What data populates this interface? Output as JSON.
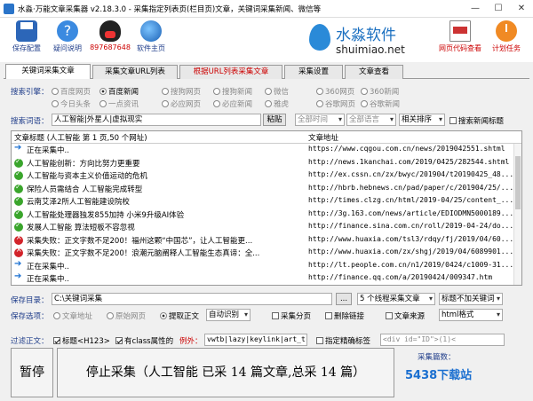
{
  "window": {
    "title": "水淼·万能文章采集器 v2.18.3.0 - 采集指定列表页(栏目页)文章，关键词采集新闻、微信等",
    "min": "—",
    "max": "☐",
    "close": "✕"
  },
  "toolbar": {
    "save": "保存配置",
    "help": "疑问说明",
    "qq": "897687648",
    "site": "软件主页",
    "logo_cn": "水淼软件",
    "logo_en": "shuimiao.net",
    "code": "网页代码查看",
    "plan": "计划任务"
  },
  "tabs": [
    "关键词采集文章",
    "采集文章URL列表",
    "根据URL列表采集文章",
    "采集设置",
    "文章查看"
  ],
  "engine": {
    "label": "搜索引擎：",
    "options": [
      "百度网页",
      "百度新闻",
      "搜狗网页",
      "搜狗新闻",
      "微信",
      "360网页",
      "360新闻",
      "今日头条",
      "一点资讯",
      "必应网页",
      "必应新闻",
      "雅虎",
      "谷歌网页",
      "谷歌新闻"
    ],
    "selected": "百度新闻"
  },
  "search": {
    "label": "搜索词语：",
    "value": "人工智能|外星人|虚拟现实",
    "paste": "粘贴",
    "time": "全部时间",
    "lang": "全部语言",
    "sort": "相关排序",
    "checkbox": "搜索新闻标题"
  },
  "table": {
    "col_title": "文章标题 (人工智能 第 1 页,50 个网址)",
    "col_url": "文章地址",
    "rows": [
      {
        "status": "arr",
        "title": "正在采集中..",
        "url": "https://www.cqgou.com.cn/news/2019042551.shtml"
      },
      {
        "status": "ok",
        "title": "人工智能创新：方向比努力更重要",
        "url": "http://news.1kanchai.com/2019/0425/282544.shtml"
      },
      {
        "status": "ok",
        "title": "人工智能与资本主义价值运动的危机",
        "url": "http://ex.cssn.cn/zx/bwyc/201904/t20190425_48..."
      },
      {
        "status": "ok",
        "title": "保险人员需结合 人工智能完成转型",
        "url": "http://hbrb.hebnews.cn/pad/paper/c/201904/25/..."
      },
      {
        "status": "ok",
        "title": "云南艾泽2所人工智能建设院校",
        "url": "http://times.clzg.cn/html/2019-04/25/content_..."
      },
      {
        "status": "ok",
        "title": "人工智能处理器独发855加持 小米9升级AI体验",
        "url": "http://3g.163.com/news/article/EDIODMN5000189..."
      },
      {
        "status": "ok",
        "title": "发展人工智能 算法短板不容忽视",
        "url": "http://finance.sina.com.cn/roll/2019-04-24/do..."
      },
      {
        "status": "err",
        "title": "采集失败：正文字数不足200！福州这颗“中国芯”，让人工智能更...",
        "url": "http://www.huaxia.com/tsl3/rdqy/fj/2019/04/60..."
      },
      {
        "status": "err",
        "title": "采集失败：正文字数不足200！浪潮元脑阐释人工智能生态真谛：全...",
        "url": "http://www.huaxia.com/zx/shgj/2019/04/6089901..."
      },
      {
        "status": "arr",
        "title": "正在采集中..",
        "url": "http://lt.people.com.cn/n1/2019/0424/c1009-31..."
      },
      {
        "status": "arr",
        "title": "正在采集中..",
        "url": "http://finance.qq.com/a/20190424/009347.htm"
      }
    ]
  },
  "save": {
    "dir_label": "保存目录：",
    "dir_value": "C:\\关键词采集",
    "browse": "...",
    "threads": "5 个线程采集文章",
    "title_dup": "标题不加关键词",
    "opt_label": "保存选项：",
    "opt_url": "文章地址",
    "opt_src": "原始网页",
    "opt_text": "提取正文",
    "mode": "自动识别",
    "paging": "采集分页",
    "del_link": "删除链接",
    "source": "文章来源",
    "format": "html格式"
  },
  "filter": {
    "label": "过滤正文：",
    "h123": "标题<H123>",
    "classattr": "有class属性的",
    "example": "例外：",
    "example_value": "vwtb|lazy|keylink|art_t)",
    "loc": "指定精确标签",
    "loc_value": "<div id=\"ID\">(1)<"
  },
  "actions": {
    "pause": "暂停",
    "stop": "停止采集（人工智能 已采 14 篇文章,总采 14 篇）",
    "total": "采集篇数：",
    "badge": "5438下载站"
  }
}
